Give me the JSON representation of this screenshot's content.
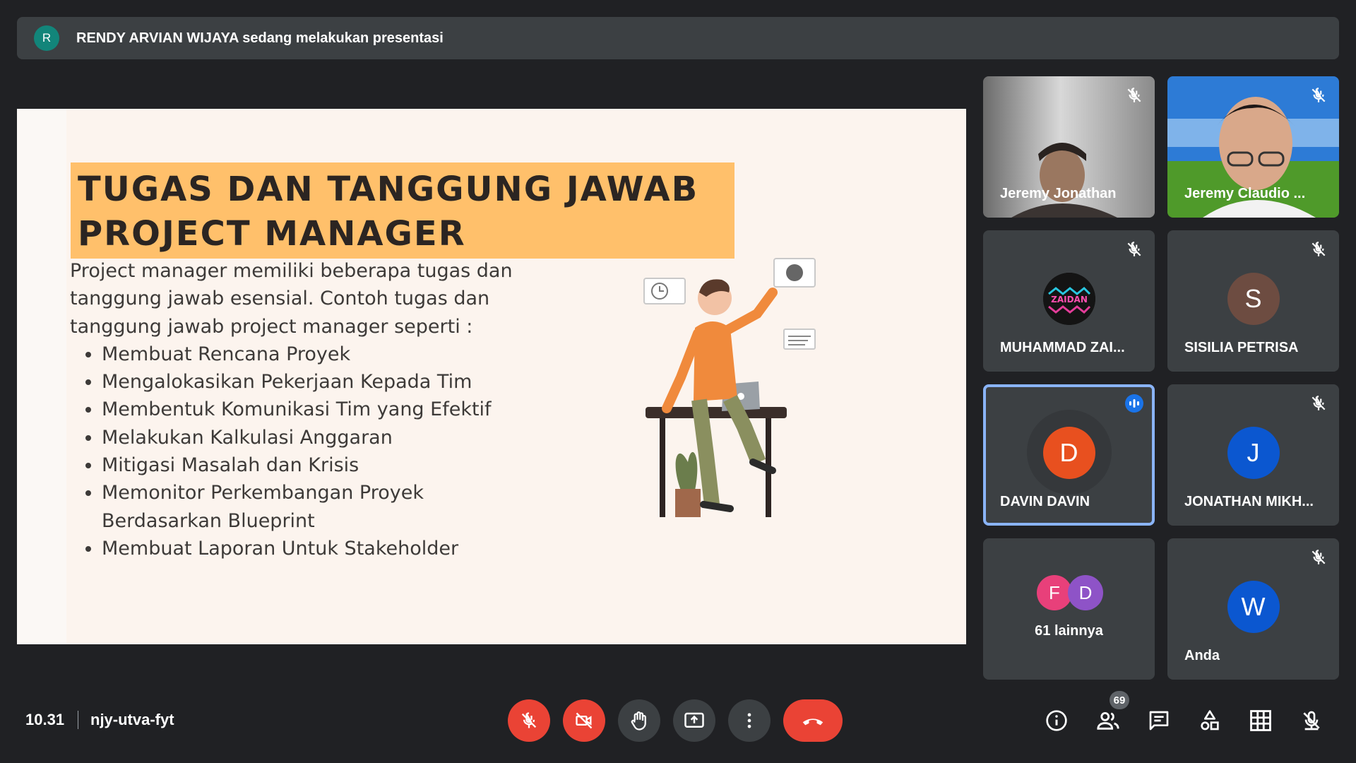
{
  "banner": {
    "avatar_letter": "R",
    "avatar_color": "#12857a",
    "text": "RENDY ARVIAN WIJAYA sedang melakukan presentasi"
  },
  "slide": {
    "title_line1": "TUGAS DAN TANGGUNG JAWAB",
    "title_line2": "PROJECT MANAGER",
    "intro_line1": "Project manager memiliki beberapa tugas dan",
    "intro_line2": "tanggung jawab esensial. Contoh tugas dan",
    "intro_line3": "tanggung jawab project manager seperti :",
    "bullets": [
      "Membuat Rencana Proyek",
      "Mengalokasikan Pekerjaan Kepada Tim",
      "Membentuk Komunikasi Tim yang Efektif",
      "Melakukan Kalkulasi Anggaran",
      "Mitigasi Masalah dan Krisis",
      "Memonitor Perkembangan Proyek Berdasarkan Blueprint",
      "Membuat Laporan Untuk Stakeholder"
    ],
    "title_bg": "#ffc06b"
  },
  "participants": [
    {
      "name": "Jeremy Jonathan",
      "kind": "video",
      "muted": true
    },
    {
      "name": "Jeremy Claudio ...",
      "kind": "video",
      "muted": true
    },
    {
      "name": "MUHAMMAD ZAI...",
      "kind": "logo",
      "logo_text": "ZAIDAN",
      "muted": true
    },
    {
      "name": "SISILIA PETRISA",
      "letter": "S",
      "color": "#6d4c41",
      "muted": true
    },
    {
      "name": "DAVIN DAVIN",
      "letter": "D",
      "color": "#e8501f",
      "speaking": true
    },
    {
      "name": "JONATHAN MIKH...",
      "letter": "J",
      "color": "#0b57d0",
      "muted": true
    },
    {
      "name": "Anda",
      "letter": "W",
      "color": "#0b57d0",
      "muted": true
    }
  ],
  "others": {
    "avatar1_letter": "F",
    "avatar1_color": "#e8407a",
    "avatar2_letter": "D",
    "avatar2_color": "#8e53c7",
    "label": "61 lainnya"
  },
  "bottom": {
    "time": "10.31",
    "meeting_code": "njy-utva-fyt",
    "people_count": "69"
  },
  "colors": {
    "danger": "#ea4335",
    "accent": "#8ab4f8",
    "surface": "#3c4043",
    "background": "#202124"
  }
}
